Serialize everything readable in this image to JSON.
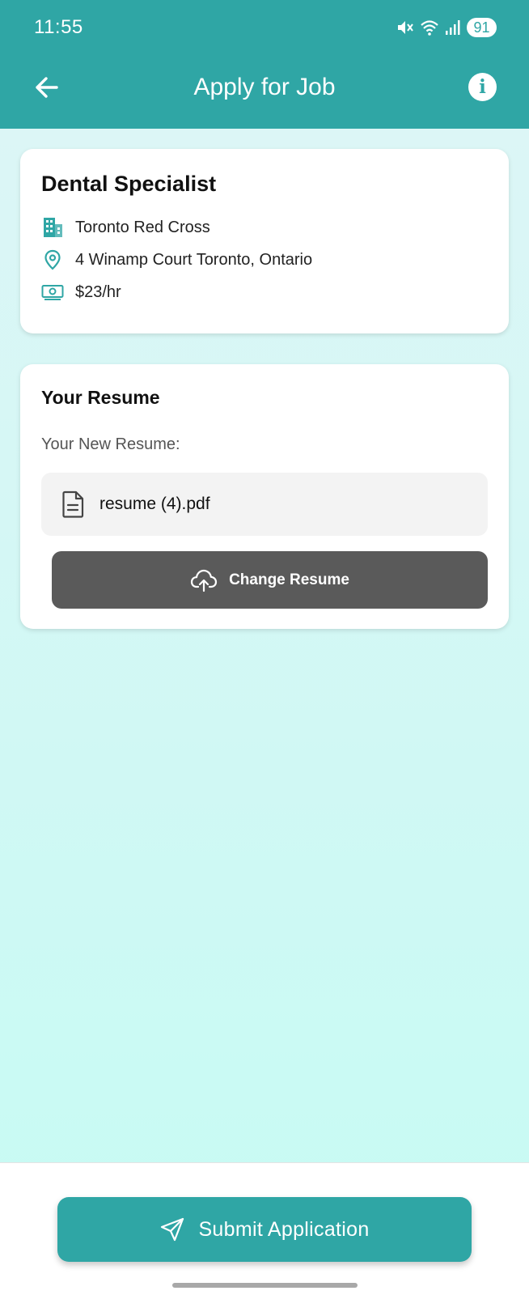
{
  "status_bar": {
    "time": "11:55",
    "battery": "91"
  },
  "header": {
    "title": "Apply for Job"
  },
  "job": {
    "title": "Dental Specialist",
    "organization": "Toronto Red Cross",
    "address": "4 Winamp Court Toronto, Ontario",
    "pay": "$23/hr"
  },
  "resume": {
    "section_title": "Your Resume",
    "label": "Your New Resume:",
    "file_name": "resume (4).pdf",
    "change_label": "Change Resume"
  },
  "footer": {
    "submit_label": "Submit Application"
  },
  "colors": {
    "primary": "#2fa6a5",
    "button_dark": "#5a5a5a",
    "background": "#c6fbf3"
  },
  "icons": [
    "mute-icon",
    "wifi-icon",
    "signal-icon",
    "back-arrow-icon",
    "info-icon",
    "building-icon",
    "location-pin-icon",
    "money-icon",
    "document-icon",
    "cloud-upload-icon",
    "send-icon"
  ]
}
